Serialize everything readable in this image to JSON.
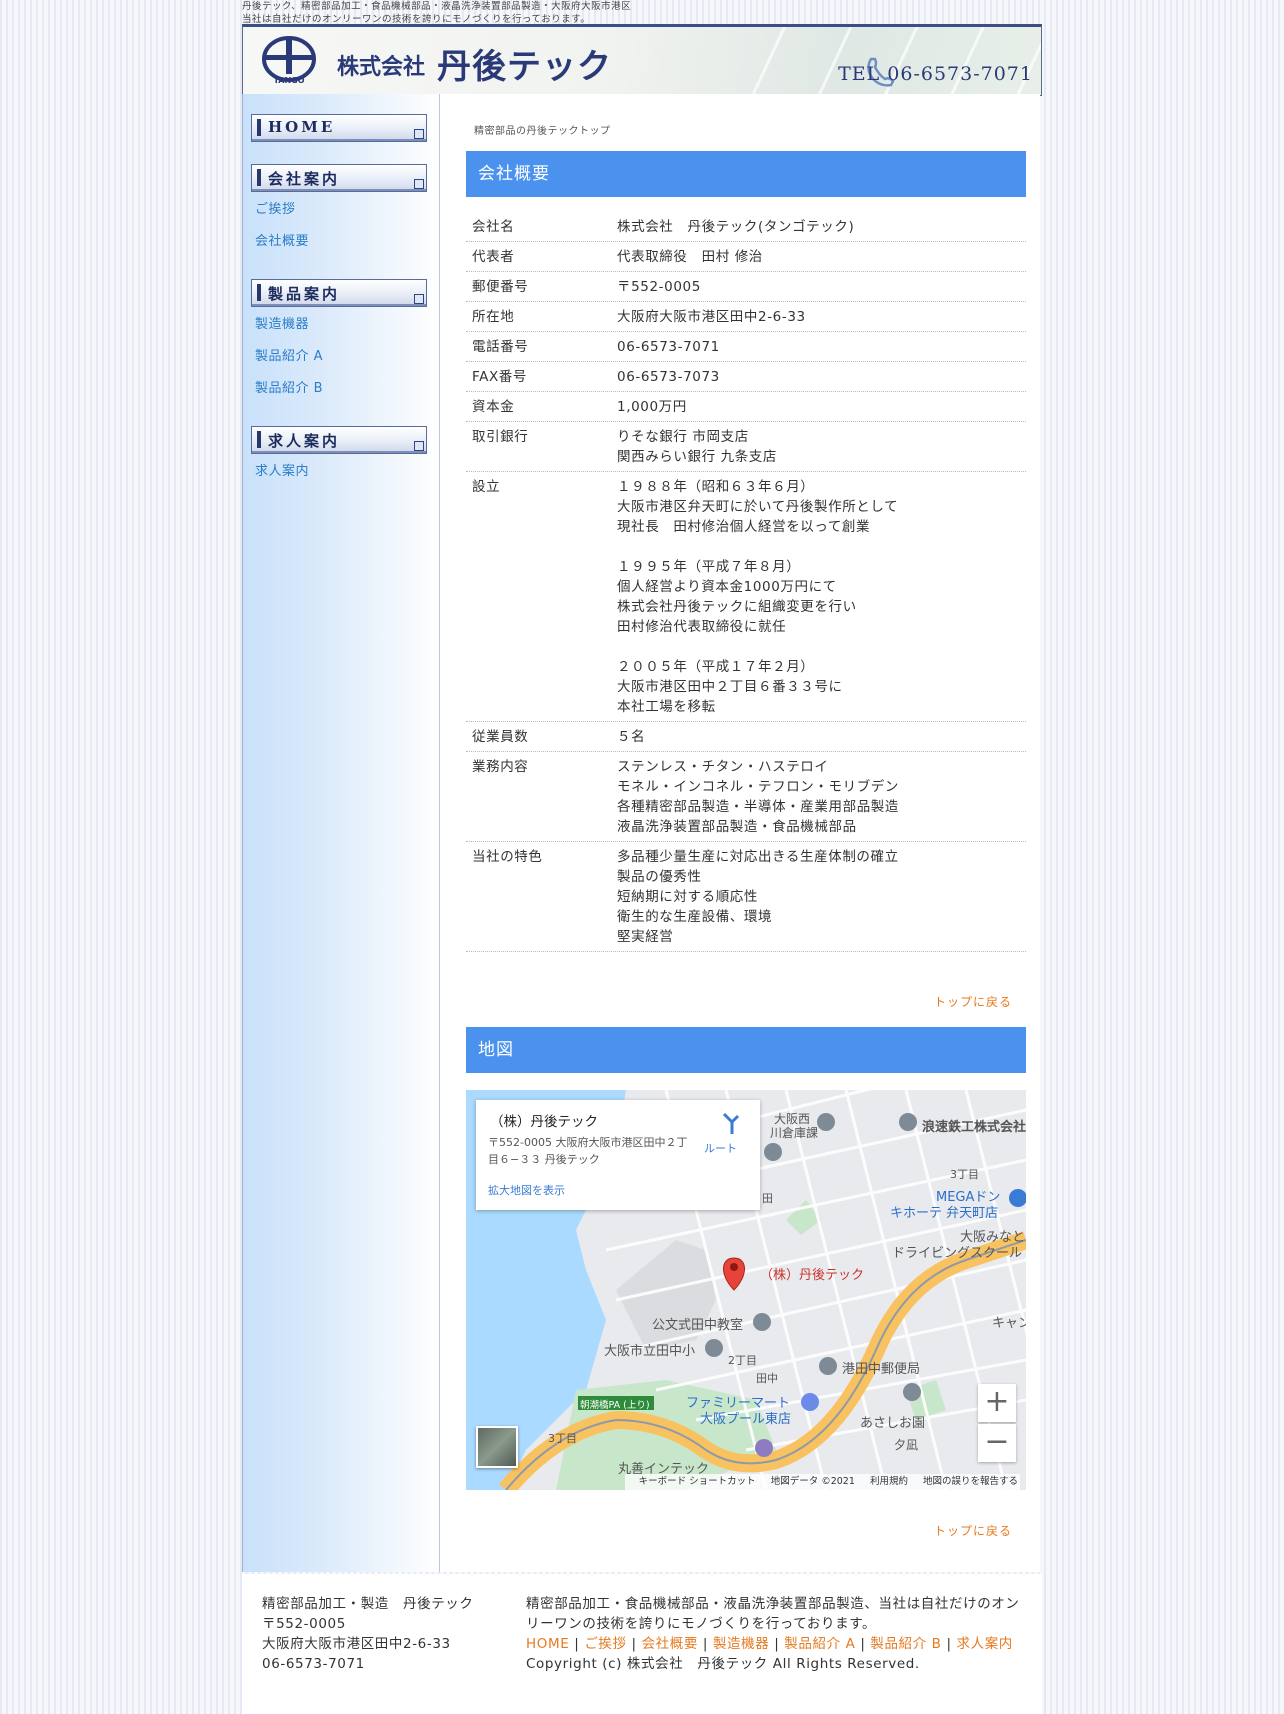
{
  "tagline": [
    "丹後テック、精密部品加工・食品機械部品・液晶洗浄装置部品製造・大阪府大阪市港区",
    "当社は自社だけのオンリーワンの技術を誇りにモノづくりを行っております。"
  ],
  "header": {
    "logo_text": "TANGO",
    "company_prefix": "株式会社",
    "company_name": "丹後テック",
    "tel": "TEL 06-6573-7071"
  },
  "sidebar": {
    "home": "HOME",
    "company_heading": "会社案内",
    "company_links": [
      "ご挨拶",
      "会社概要"
    ],
    "products_heading": "製品案内",
    "products_links": [
      "製造機器",
      "製品紹介 A",
      "製品紹介 B"
    ],
    "recruit_heading": "求人案内",
    "recruit_links": [
      "求人案内"
    ]
  },
  "breadcrumb": "精密部品の丹後テックトップ",
  "overview": {
    "heading": "会社概要",
    "rows": [
      {
        "k": "会社名",
        "v": "株式会社　丹後テック(タンゴテック)"
      },
      {
        "k": "代表者",
        "v": "代表取締役　田村 修治"
      },
      {
        "k": "郵便番号",
        "v": "〒552-0005"
      },
      {
        "k": "所在地",
        "v": "大阪府大阪市港区田中2-6-33"
      },
      {
        "k": "電話番号",
        "v": "06-6573-7071"
      },
      {
        "k": "FAX番号",
        "v": "06-6573-7073"
      },
      {
        "k": "資本金",
        "v": "1,000万円"
      },
      {
        "k": "取引銀行",
        "v": "りそな銀行  市岡支店\n関西みらい銀行  九条支店"
      },
      {
        "k": "設立",
        "v": "１９８８年（昭和６３年６月）\n大阪市港区弁天町に於いて丹後製作所として\n現社長　田村修治個人経営を以って創業\n\n１９９５年（平成７年８月）\n個人経営より資本金1000万円にて\n株式会社丹後テックに組織変更を行い\n田村修治代表取締役に就任\n\n２００５年（平成１７年２月）\n大阪市港区田中２丁目６番３３号に\n本社工場を移転"
      },
      {
        "k": "従業員数",
        "v": "５名"
      },
      {
        "k": "業務内容",
        "v": "ステンレス・チタン・ハステロイ\nモネル・インコネル・テフロン・モリブデン\n各種精密部品製造・半導体・産業用部品製造\n液晶洗浄装置部品製造・食品機械部品"
      },
      {
        "k": "当社の特色",
        "v": "多品種少量生産に対応出きる生産体制の確立\n製品の優秀性\n短納期に対する順応性\n衛生的な生産設備、環境\n堅実経営"
      }
    ],
    "to_top": "トップに戻る"
  },
  "map_section": {
    "heading": "地図",
    "card_title": "（株）丹後テック",
    "card_address": "〒552-0005 大阪府大阪市港区田中２丁目６−３３ 丹後テック",
    "card_route": "ルート",
    "card_enlarge": "拡大地図を表示",
    "labels": {
      "pin": "（株）丹後テック",
      "kumon": "公文式田中教室",
      "school": "大阪市立田中小",
      "nichome": "2丁目",
      "tanaka": "田中",
      "post": "港田中郵便局",
      "famima1": "ファミリーマート",
      "famima2": "大阪プール東店",
      "pa": "朝潮橋PA (上り)",
      "asashio": "あさしお園",
      "maruzen": "丸善インテック",
      "sanchome": "3丁目",
      "sanchome2": "3丁目",
      "yuunagi": "夕凪",
      "naniwa": "浪速鉄工株式会社",
      "osakanishi1": "大阪西",
      "osakanishi2": "川倉庫課",
      "mega1": "MEGAドン",
      "mega2": "キホーテ 弁天町店",
      "minato1": "大阪みなと",
      "minato2": "ドライビングスクール",
      "kyan": "キャン",
      "den": "田"
    },
    "zoom_in": "+",
    "zoom_out": "−",
    "footer": [
      "キーボード ショートカット",
      "地図データ ©2021",
      "利用規約",
      "地図の誤りを報告する"
    ],
    "to_top": "トップに戻る"
  },
  "footer": {
    "left": [
      "精密部品加工・製造　丹後テック",
      "〒552-0005",
      "大阪府大阪市港区田中2-6-33",
      "06-6573-7071"
    ],
    "description": "精密部品加工・食品機械部品・液晶洗浄装置部品製造、当社は自社だけのオンリーワンの技術を誇りにモノづくりを行っております。",
    "links": [
      "HOME",
      "ご挨拶",
      "会社概要",
      "製造機器",
      "製品紹介 A",
      "製品紹介 B",
      "求人案内"
    ],
    "copyright": "Copyright (c) 株式会社　丹後テック All Rights Reserved."
  },
  "colors": {
    "accent": "#4b92ee",
    "link": "#2a7dc8",
    "orange": "#e67a20",
    "navy": "#2a3a78"
  }
}
